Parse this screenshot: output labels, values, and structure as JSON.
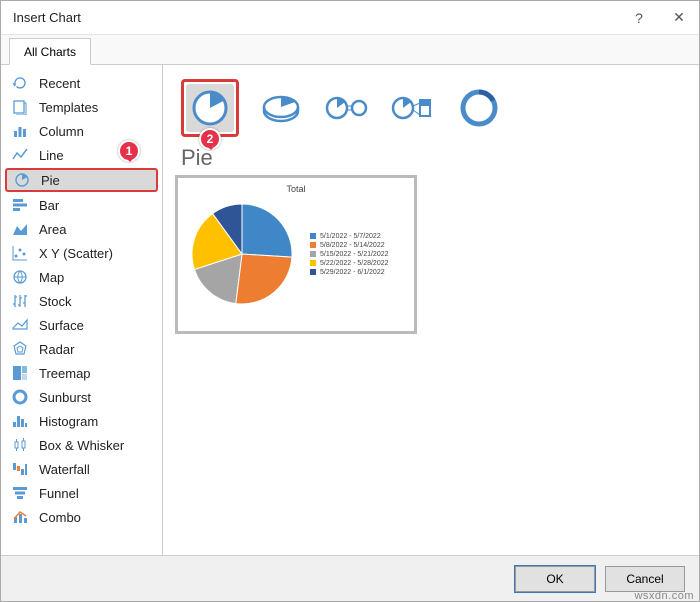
{
  "window": {
    "title": "Insert Chart",
    "help": "?",
    "close": "✕"
  },
  "tabs": {
    "all": "All Charts"
  },
  "sidebar": {
    "items": [
      {
        "label": "Recent"
      },
      {
        "label": "Templates"
      },
      {
        "label": "Column"
      },
      {
        "label": "Line"
      },
      {
        "label": "Pie"
      },
      {
        "label": "Bar"
      },
      {
        "label": "Area"
      },
      {
        "label": "X Y (Scatter)"
      },
      {
        "label": "Map"
      },
      {
        "label": "Stock"
      },
      {
        "label": "Surface"
      },
      {
        "label": "Radar"
      },
      {
        "label": "Treemap"
      },
      {
        "label": "Sunburst"
      },
      {
        "label": "Histogram"
      },
      {
        "label": "Box & Whisker"
      },
      {
        "label": "Waterfall"
      },
      {
        "label": "Funnel"
      },
      {
        "label": "Combo"
      }
    ]
  },
  "main": {
    "subtitle": "Pie",
    "preview_title": "Total",
    "legend": [
      {
        "label": "5/1/2022 - 5/7/2022",
        "color": "#3f87c6"
      },
      {
        "label": "5/8/2022 - 5/14/2022",
        "color": "#ed7d31"
      },
      {
        "label": "5/15/2022 - 5/21/2022",
        "color": "#a5a5a5"
      },
      {
        "label": "5/22/2022 - 5/28/2022",
        "color": "#ffc000"
      },
      {
        "label": "5/29/2022 - 6/1/2022",
        "color": "#2f5597"
      }
    ]
  },
  "footer": {
    "ok": "OK",
    "cancel": "Cancel"
  },
  "callouts": {
    "one": "1",
    "two": "2"
  },
  "watermark": "wsxdn.com",
  "chart_data": {
    "type": "pie",
    "title": "Total",
    "series": [
      {
        "name": "5/1/2022 - 5/7/2022",
        "value": 26,
        "color": "#3f87c6"
      },
      {
        "name": "5/8/2022 - 5/14/2022",
        "value": 26,
        "color": "#ed7d31"
      },
      {
        "name": "5/15/2022 - 5/21/2022",
        "value": 18,
        "color": "#a5a5a5"
      },
      {
        "name": "5/22/2022 - 5/28/2022",
        "value": 20,
        "color": "#ffc000"
      },
      {
        "name": "5/29/2022 - 6/1/2022",
        "value": 10,
        "color": "#2f5597"
      }
    ]
  }
}
